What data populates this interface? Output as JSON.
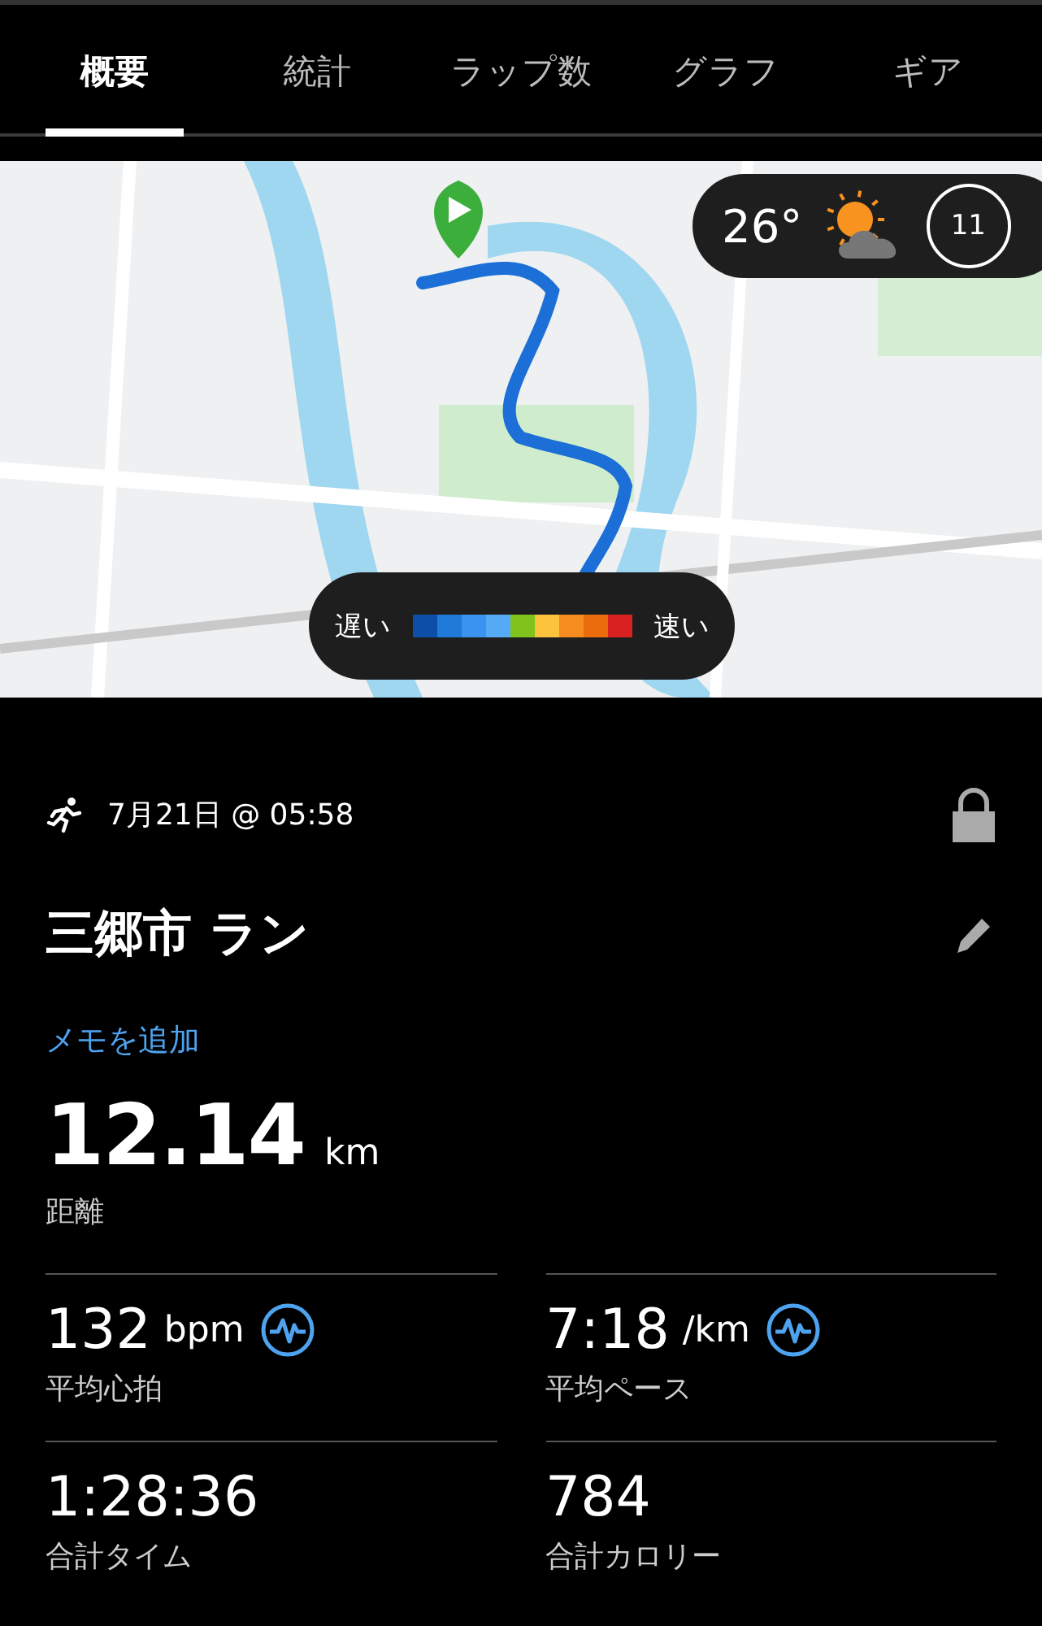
{
  "tabs": [
    {
      "label": "概要",
      "selected": true
    },
    {
      "label": "統計",
      "selected": false
    },
    {
      "label": "ラップ数",
      "selected": false
    },
    {
      "label": "グラフ",
      "selected": false
    },
    {
      "label": "ギア",
      "selected": false
    }
  ],
  "map": {
    "kind": "picture",
    "weather": {
      "temperature": "26°",
      "wind_speed": "11"
    },
    "speed_legend": {
      "slow": "遅い",
      "fast": "速い",
      "segments": [
        {
          "color": "#0d4fa8"
        },
        {
          "color": "#1f7ad8"
        },
        {
          "color": "#3a93ee"
        },
        {
          "color": "#56a9f5"
        },
        {
          "color": "#7fc31c"
        },
        {
          "color": "#fcc43c"
        },
        {
          "color": "#f68b1f"
        },
        {
          "color": "#ea6c0c"
        },
        {
          "color": "#d8221f"
        }
      ]
    }
  },
  "activity": {
    "date": "7月21日 @ 05:58",
    "locked": true,
    "title": "三郷市 ラン",
    "add_note": "メモを追加"
  },
  "main_stat": {
    "value": "12.14",
    "unit": "km",
    "label": "距離"
  },
  "stats": [
    {
      "value": "132",
      "unit": "bpm",
      "label": "平均心拍",
      "graph_link": true
    },
    {
      "value": "7:18",
      "unit": "/km",
      "label": "平均ペース",
      "graph_link": true
    },
    {
      "value": "1:28:36",
      "label": "合計タイム",
      "graph_link": false
    },
    {
      "value": "784",
      "label": "合計カロリー",
      "graph_link": false
    }
  ]
}
